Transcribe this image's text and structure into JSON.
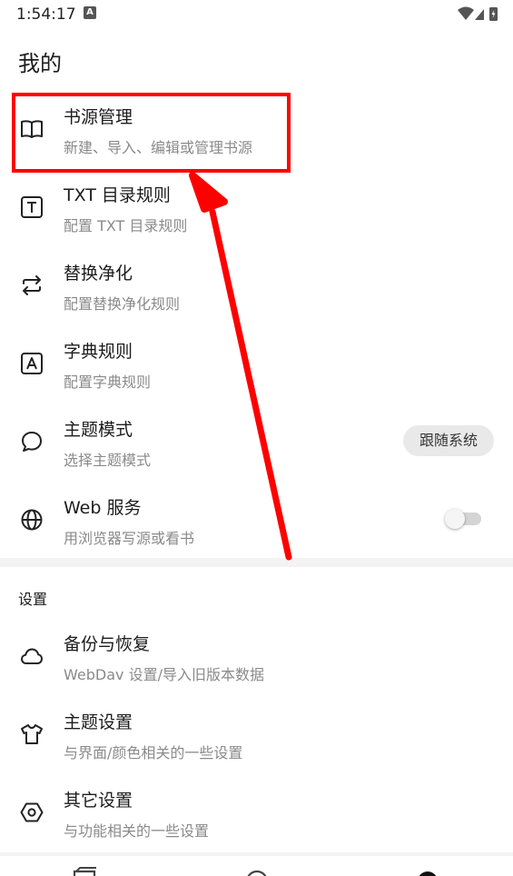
{
  "status_bar": {
    "time": "1:54:17",
    "notification_glyph": "A"
  },
  "page": {
    "title": "我的"
  },
  "items": [
    {
      "title": "书源管理",
      "subtitle": "新建、导入、编辑或管理书源",
      "icon": "book-open-icon"
    },
    {
      "title": "TXT 目录规则",
      "subtitle": "配置 TXT 目录规则",
      "icon": "text-box-icon"
    },
    {
      "title": "替换净化",
      "subtitle": "配置替换净化规则",
      "icon": "swap-arrows-icon"
    },
    {
      "title": "字典规则",
      "subtitle": "配置字典规则",
      "icon": "letter-a-box-icon"
    },
    {
      "title": "主题模式",
      "subtitle": "选择主题模式",
      "icon": "chat-bubble-icon",
      "chip": "跟随系统"
    },
    {
      "title": "Web 服务",
      "subtitle": "用浏览器写源或看书",
      "icon": "globe-icon",
      "toggle_on": false
    }
  ],
  "settings": {
    "label": "设置",
    "items": [
      {
        "title": "备份与恢复",
        "subtitle": "WebDav 设置/导入旧版本数据",
        "icon": "cloud-icon"
      },
      {
        "title": "主题设置",
        "subtitle": "与界面/颜色相关的一些设置",
        "icon": "tshirt-icon"
      },
      {
        "title": "其它设置",
        "subtitle": "与功能相关的一些设置",
        "icon": "gear-icon"
      }
    ]
  },
  "colors": {
    "highlight": "#ff0000",
    "arrow": "#ff0000"
  }
}
